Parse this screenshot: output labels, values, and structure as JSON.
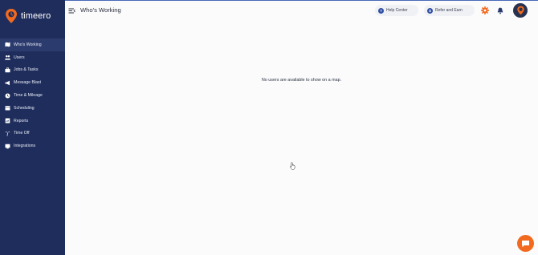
{
  "brand": {
    "name": "timeero",
    "accent": "#f26a20"
  },
  "header": {
    "title": "Who's Working",
    "help_label": "Help Center",
    "refer_label": "Refer and Earn"
  },
  "sidebar": {
    "items": [
      {
        "label": "Who's Working",
        "icon": "map-icon",
        "active": true
      },
      {
        "label": "Users",
        "icon": "users-icon"
      },
      {
        "label": "Jobs & Tasks",
        "icon": "briefcase-icon"
      },
      {
        "label": "Message Blast",
        "icon": "megaphone-icon"
      },
      {
        "label": "Time & Mileage",
        "icon": "clock-icon"
      },
      {
        "label": "Scheduling",
        "icon": "calendar-icon"
      },
      {
        "label": "Reports",
        "icon": "report-icon"
      },
      {
        "label": "Time Off",
        "icon": "palm-icon"
      },
      {
        "label": "Integrations",
        "icon": "integrations-icon"
      }
    ]
  },
  "main": {
    "empty_message": "No users are available to show on a map."
  },
  "colors": {
    "sidebar": "#1f2d5c",
    "accent": "#f26a20",
    "primary": "#2e4ea3"
  }
}
